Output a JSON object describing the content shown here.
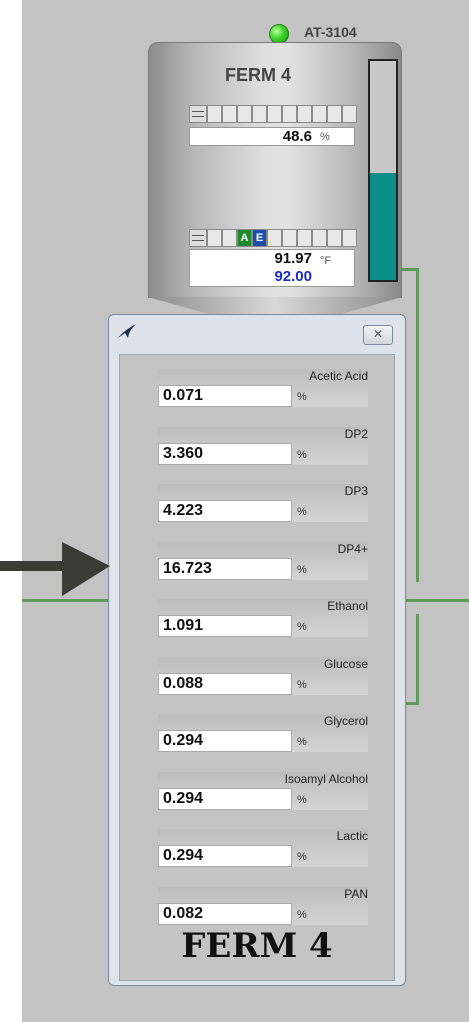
{
  "tank": {
    "tag": "AT-3104",
    "title": "FERM 4",
    "level_value": "48.6",
    "level_unit": "%",
    "temp_value": "91.97",
    "temp_setpoint": "92.00",
    "temp_unit": "°F",
    "mode_a": "A",
    "mode_e": "E",
    "level_fraction": 0.49
  },
  "popup": {
    "close_label": "✕",
    "footer": "FERM 4",
    "analytes": [
      {
        "label": "Acetic Acid",
        "value": "0.071",
        "unit": "%"
      },
      {
        "label": "DP2",
        "value": "3.360",
        "unit": "%"
      },
      {
        "label": "DP3",
        "value": "4.223",
        "unit": "%"
      },
      {
        "label": "DP4+",
        "value": "16.723",
        "unit": "%"
      },
      {
        "label": "Ethanol",
        "value": "1.091",
        "unit": "%"
      },
      {
        "label": "Glucose",
        "value": "0.088",
        "unit": "%"
      },
      {
        "label": "Glycerol",
        "value": "0.294",
        "unit": "%"
      },
      {
        "label": "Isoamyl Alcohol",
        "value": "0.294",
        "unit": "%"
      },
      {
        "label": "Lactic",
        "value": "0.294",
        "unit": "%"
      },
      {
        "label": "PAN",
        "value": "0.082",
        "unit": "%"
      }
    ]
  },
  "colors": {
    "pipe": "#5e9a58",
    "status_ok": "#3bd42a",
    "level_fill": "#0c8f8a"
  }
}
